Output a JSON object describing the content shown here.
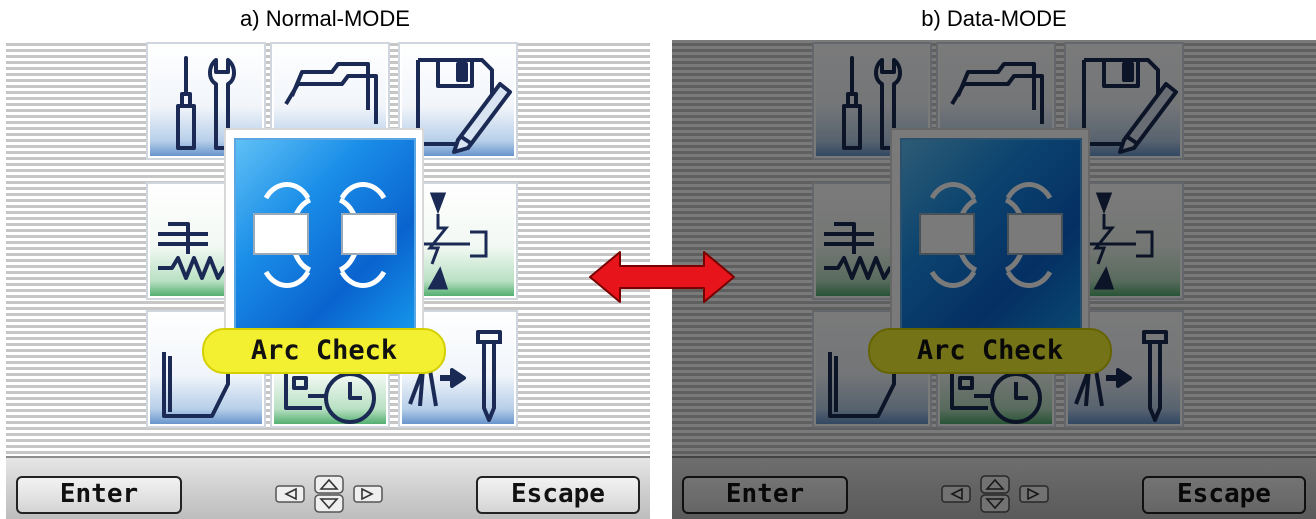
{
  "captions": {
    "normal": "a) Normal-MODE",
    "data": "b) Data-MODE"
  },
  "menu": {
    "selected_label": "Arc Check",
    "selected_icon": "arc-check-icon",
    "tiles": [
      "tools-icon",
      "folder-icon",
      "save-edit-icon",
      "circuit-icon",
      "arc-check-icon",
      "welding-torch-icon",
      "document-icon",
      "schedule-clock-icon",
      "feeder-nail-icon"
    ]
  },
  "bottombar": {
    "enter_label": "Enter",
    "escape_label": "Escape",
    "dpad_icon": "directional-pad-icon"
  },
  "colors": {
    "focus_blue": "#0a63cf",
    "label_yellow": "#f3f032",
    "tile_blue": "#5e8dc9",
    "tile_green": "#46a866",
    "mode_arrow": "#e8141c",
    "data_mode_dim": "#000000"
  }
}
